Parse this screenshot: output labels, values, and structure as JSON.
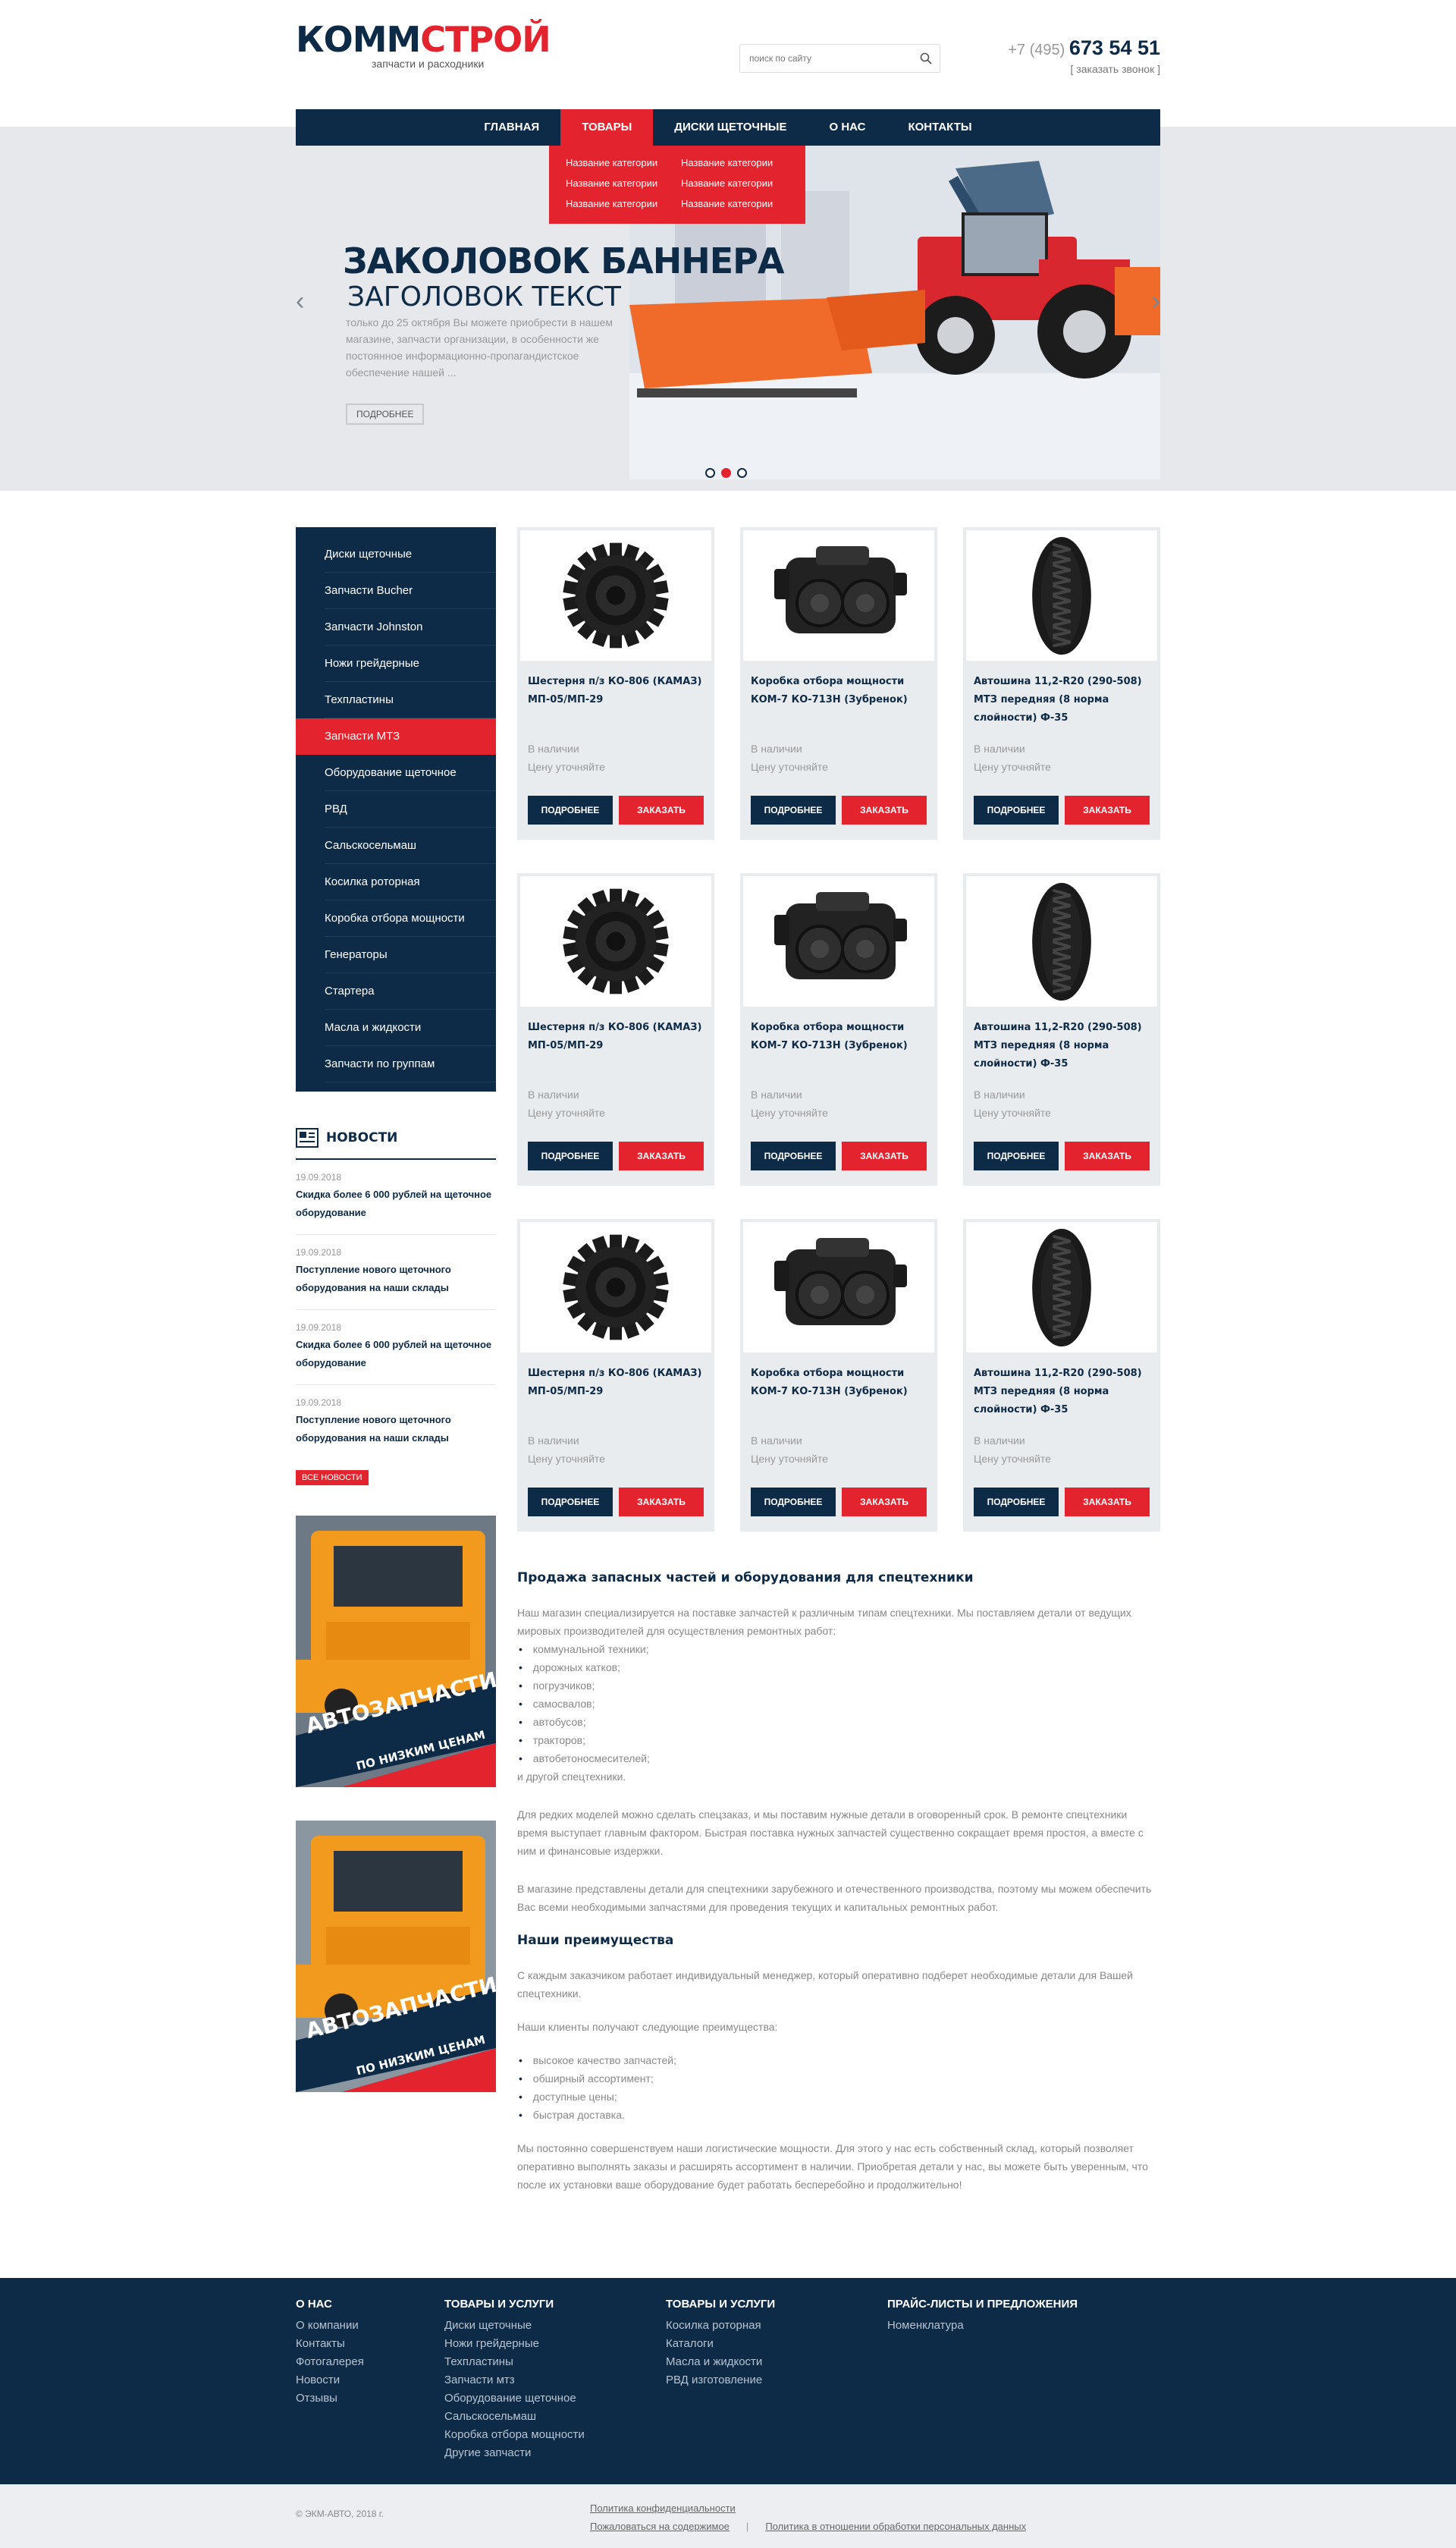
{
  "header": {
    "logo_part1": "КОММ",
    "logo_part2": "СТРОЙ",
    "tagline": "запчасти и расходники",
    "search_placeholder": "поиск по сайту",
    "phone_code": "+7 (495)",
    "phone_number": "673 54 51",
    "callback": "[ заказать звонок ]"
  },
  "nav": {
    "items": [
      "ГЛАВНАЯ",
      "ТОВАРЫ",
      "ДИСКИ ЩЕТОЧНЫЕ",
      "О НАС",
      "КОНТАКТЫ"
    ],
    "active": "ТОВАРЫ",
    "dropdown": [
      "Название категории",
      "Название категории",
      "Название категории",
      "Название категории",
      "Название категории",
      "Название категории"
    ]
  },
  "hero": {
    "title": "ЗАКОЛОВОК БАННЕРА",
    "subtitle": "ЗАГОЛОВОК ТЕКСТ",
    "text": "только до 25 октября Вы можете приобрести в нашем магазине, запчасти организации, в особенности же постоянное информационно-пропагандистское обеспечение нашей ...",
    "button": "ПОДРОБНЕЕ",
    "prev": "‹",
    "next": "›"
  },
  "sidebar": {
    "categories": [
      "Диски щеточные",
      "Запчасти Bucher",
      "Запчасти Johnston",
      "Ножи грейдерные",
      "Техпластины",
      "Запчасти МТЗ",
      "Оборудование щеточное",
      "РВД",
      "Сальскосельмаш",
      "Косилка роторная",
      "Коробка отбора мощности",
      "Генераторы",
      "Стартера",
      "Масла и жидкости",
      "Запчасти по группам"
    ],
    "active_category": "Запчасти МТЗ",
    "news_title": "НОВОСТИ",
    "news": [
      {
        "date": "19.09.2018",
        "title": "Скидка более  6 000 рублей на щеточное оборудование"
      },
      {
        "date": "19.09.2018",
        "title": "Поступление нового щеточного оборудования на наши склады"
      },
      {
        "date": "19.09.2018",
        "title": "Скидка более  6 000 рублей на щеточное оборудование"
      },
      {
        "date": "19.09.2018",
        "title": "Поступление нового щеточного оборудования на наши склады"
      }
    ],
    "all_news": "ВСЕ НОВОСТИ",
    "promo_line1": "АВТОЗАПЧАСТИ",
    "promo_line2": "ПО НИЗКИМ ЦЕНАМ"
  },
  "products": [
    {
      "name": "Шестерня п/з КО-806 (КАМАЗ) МП-05/МП-29",
      "stock": "В наличии",
      "price": "Цену уточняйте",
      "img": "gear-icon"
    },
    {
      "name": "Коробка отбора мощности КОМ-7 КО-713Н (Зубренок)",
      "stock": "В наличии",
      "price": "Цену уточняйте",
      "img": "gearbox-icon"
    },
    {
      "name": "Автошина 11,2-R20 (290-508) МТЗ передняя (8 норма слойности) Ф-35",
      "stock": "В наличии",
      "price": "Цену уточняйте",
      "img": "tire-icon"
    },
    {
      "name": "Шестерня п/з КО-806 (КАМАЗ) МП-05/МП-29",
      "stock": "В наличии",
      "price": "Цену уточняйте",
      "img": "gear-icon"
    },
    {
      "name": "Коробка отбора мощности КОМ-7 КО-713Н (Зубренок)",
      "stock": "В наличии",
      "price": "Цену уточняйте",
      "img": "gearbox-icon"
    },
    {
      "name": "Автошина 11,2-R20 (290-508) МТЗ передняя (8 норма слойности) Ф-35",
      "stock": "В наличии",
      "price": "Цену уточняйте",
      "img": "tire-icon"
    },
    {
      "name": "Шестерня п/з КО-806 (КАМАЗ) МП-05/МП-29",
      "stock": "В наличии",
      "price": "Цену уточняйте",
      "img": "gear-icon"
    },
    {
      "name": "Коробка отбора мощности КОМ-7 КО-713Н (Зубренок)",
      "stock": "В наличии",
      "price": "Цену уточняйте",
      "img": "gearbox-icon"
    },
    {
      "name": "Автошина 11,2-R20 (290-508) МТЗ передняя (8 норма слойности) Ф-35",
      "stock": "В наличии",
      "price": "Цену уточняйте",
      "img": "tire-icon"
    }
  ],
  "buttons": {
    "details": "ПОДРОБНЕЕ",
    "order": "ЗАКАЗАТЬ"
  },
  "article": {
    "h1": "Продажа запасных частей и оборудования для спецтехники",
    "intro": "Наш магазин специализируется на поставке запчастей к различным типам спецтехники. Мы поставляем детали от ведущих мировых производителей для осуществления ремонтных работ:",
    "list1": [
      "коммунальной техники;",
      "дорожных катков;",
      "погрузчиков;",
      "самосвалов;",
      "автобусов;",
      "тракторов;",
      "автобетоносмесителей;"
    ],
    "after_list": "и другой спецтехники.",
    "p2": "Для редких моделей можно сделать спецзаказ, и мы поставим нужные детали в оговоренный срок. В ремонте спецтехники время выступает главным фактором. Быстрая поставка нужных запчастей существенно сокращает время простоя, а вместе с ним и финансовые издержки.",
    "p3": "В магазине представлены детали для спецтехники зарубежного и отечественного производства, поэтому мы можем обеспечить Вас всеми необходимыми запчастями для проведения текущих и капитальных ремонтных работ.",
    "h2": "Наши преимущества",
    "p4": "С каждым заказчиком работает индивидуальный менеджер, который оперативно подберет необходимые детали для Вашей спецтехники.",
    "p5": "Наши клиенты получают следующие преимущества:",
    "list2": [
      "высокое качество запчастей;",
      "обширный ассортимент;",
      "доступные цены;",
      "быстрая доставка."
    ],
    "p6": "Мы постоянно совершенствуем наши логистические мощности. Для этого у нас есть собственный склад, который позволяет оперативно выполнять заказы и расширять ассортимент в наличии. Приобретая детали у нас, вы можете быть уверенным, что после их установки ваше оборудование будет работать бесперебойно и продолжительно!"
  },
  "footer": {
    "cols": [
      {
        "title": "О НАС",
        "links": [
          "О компании",
          "Контакты",
          "Фотогалерея",
          "Новости",
          "Отзывы"
        ]
      },
      {
        "title": "ТОВАРЫ И УСЛУГИ",
        "links": [
          "Диски щеточные",
          "Ножи грейдерные",
          "Техпластины",
          "Запчасти мтз",
          "Оборудование щеточное",
          "Сальскосельмаш",
          "Коробка отбора мощности",
          "Другие запчасти"
        ]
      },
      {
        "title": "ТОВАРЫ И УСЛУГИ",
        "links": [
          "Косилка роторная",
          "Каталоги",
          "Масла и жидкости",
          "РВД изготовление"
        ]
      },
      {
        "title": "ПРАЙС-ЛИСТЫ И ПРЕДЛОЖЕНИЯ",
        "links": [
          "Номенклатура"
        ]
      }
    ],
    "copyright": "© ЭКМ-АВТО, 2018 г.",
    "privacy": "Политика конфиденциальности",
    "complain": "Пожаловаться на содержимое",
    "sep": "|",
    "personal": "Политика в отношении обработки персональных данных"
  },
  "colors": {
    "navy": "#0d2a46",
    "red": "#e3232d",
    "card_bg": "#e9ecef",
    "hero_bg": "#e6e8ec"
  }
}
